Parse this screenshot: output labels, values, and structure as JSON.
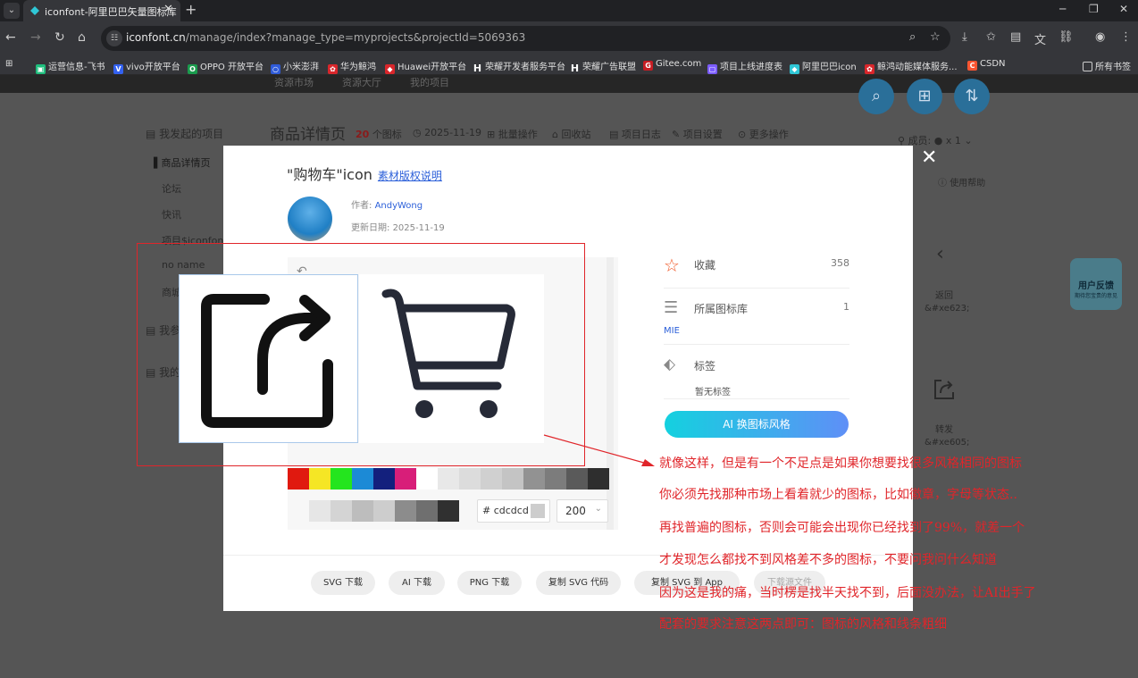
{
  "browser": {
    "tab_title": "iconfont-阿里巴巴矢量图标库",
    "url_host": "iconfont.cn",
    "url_path": "/manage/index?manage_type=myprojects&projectId=5069363",
    "bookmarks": [
      "运营信息-飞书",
      "vivo开放平台",
      "OPPO 开放平台",
      "小米澎湃",
      "华为鲸鸿",
      "Huawei开放平台",
      "荣耀开发者服务平台",
      "荣耀广告联盟",
      "Gitee.com",
      "项目上线进度表",
      "阿里巴巴icon",
      "鲸鸿动能媒体服务...",
      "CSDN"
    ],
    "all_bookmarks": "所有书签"
  },
  "page": {
    "top_tabs": [
      "资源市场",
      "资源大厅",
      "我的项目"
    ],
    "sidebar_head1": "我发起的项目",
    "sidebar_items": [
      "商品详情页",
      "论坛",
      "快讯",
      "项目$iconfont",
      "no name",
      "商城"
    ],
    "sidebar_head2": "我参",
    "sidebar_head3": "我的",
    "project_title": "商品详情页",
    "project_count": "20",
    "project_count_unit": "个图标",
    "project_date": "2025-11-19",
    "actions": [
      "批量操作",
      "回收站",
      "项目日志",
      "项目设置",
      "更多操作"
    ],
    "member_label": "成员:",
    "member_count": "x 1",
    "help": "使用帮助",
    "right_icon1_label": "返回",
    "right_icon1_code": "&#xe623;",
    "right_icon2_label": "转发",
    "right_icon2_code": "&#xe605;",
    "feedback_title": "用户反馈",
    "feedback_sub": "期待您宝贵的意见"
  },
  "modal": {
    "title": "\"购物车\"icon",
    "license": "素材版权说明",
    "author_label": "作者:",
    "author": "AndyWong",
    "date_label": "更新日期:",
    "date": "2025-11-19",
    "fav_label": "收藏",
    "fav_count": "358",
    "lib_label": "所属图标库",
    "lib_count": "1",
    "lib_name": "MIE",
    "tag_label": "标签",
    "tag_value": "暂无标签",
    "ai_button": "AI 换图标风格",
    "hex_value": "cdcdcd",
    "hex_prefix": "#",
    "size_value": "200",
    "colors_row1": [
      "#e0190f",
      "#f5e625",
      "#24e51e",
      "#1c8ad6",
      "#13207d",
      "#d81e79",
      "#ffffff",
      "#e8e8e8",
      "#dcdcdc",
      "#d0d0d0",
      "#c4c4c4",
      "#929292",
      "#7c7c7c",
      "#5a5a5a",
      "#2e2e2e"
    ],
    "colors_row2": [
      "#e6e6e6",
      "#d4d4d4",
      "#bdbdbd",
      "#cdcdcd",
      "#8c8c8c",
      "#6f6f6f",
      "#303030"
    ],
    "buttons": [
      "SVG 下载",
      "AI 下载",
      "PNG 下载",
      "复制 SVG 代码",
      "复制 SVG 到 App",
      "下载源文件"
    ]
  },
  "annotation": {
    "lines": [
      "就像这样，但是有一个不足点是如果你想要找很多风格相同的图标",
      "你必须先找那种市场上看着就少的图标，比如徽章，字母等状态..",
      "再找普遍的图标，否则会可能会出现你已经找到了99%，就差一个",
      "才发现怎么都找不到风格差不多的图标，不要问我问什么知道",
      "因为这是我的痛，当时楞是找半天找不到，后面没办法，让AI出手了",
      "配套的要求注意这两点即可：图标的风格和线条粗细"
    ],
    "color": "#e0252a"
  }
}
